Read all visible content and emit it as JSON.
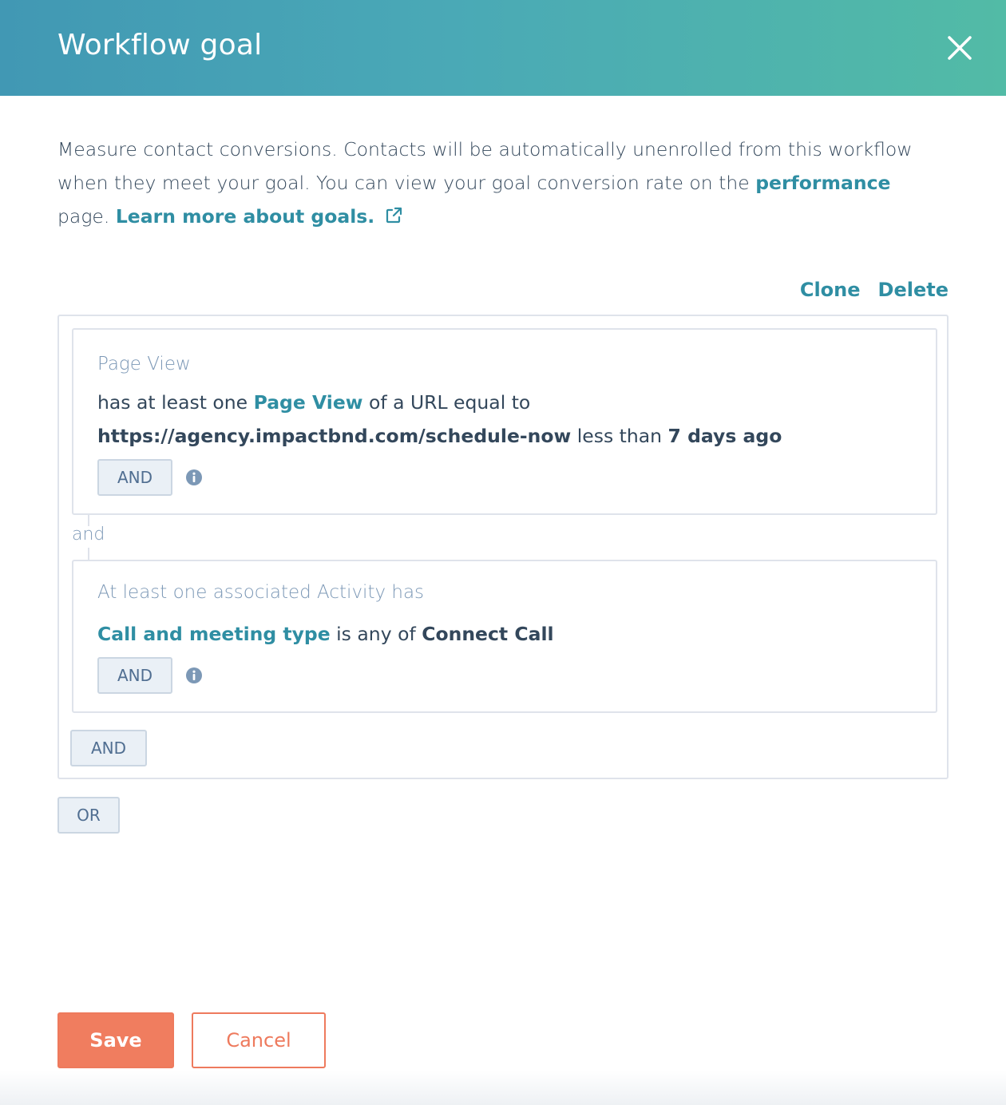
{
  "dialog": {
    "title": "Workflow goal"
  },
  "intro": {
    "text1": "Measure contact conversions. Contacts will be automatically unenrolled from this workflow when they meet your goal. You can view your goal conversion rate on the ",
    "performance_link": "performance",
    "text2": " page. ",
    "learn_link": "Learn more about goals."
  },
  "actions": {
    "clone": "Clone",
    "delete": "Delete"
  },
  "filters": [
    {
      "heading": "Page View",
      "text_a": "has at least one ",
      "link": "Page View",
      "text_b": " of a URL equal to ",
      "value": "https://agency.impactbnd.com/schedule-now",
      "text_c": " less than ",
      "value2": "7 days ago",
      "and_button": "AND"
    },
    {
      "heading": "At least one associated Activity has",
      "link": "Call and meeting type",
      "text_a": " is any of ",
      "value": "Connect Call",
      "and_button": "AND"
    }
  ],
  "connector_label": "and",
  "group_and_button": "AND",
  "or_button": "OR",
  "footer": {
    "save": "Save",
    "cancel": "Cancel"
  },
  "colors": {
    "header_start": "#4198b4",
    "header_end": "#52bba6",
    "link": "#2f8ea3",
    "primary": "#f07d5f"
  },
  "icons": [
    "close-icon",
    "external-link-icon",
    "info-icon"
  ]
}
